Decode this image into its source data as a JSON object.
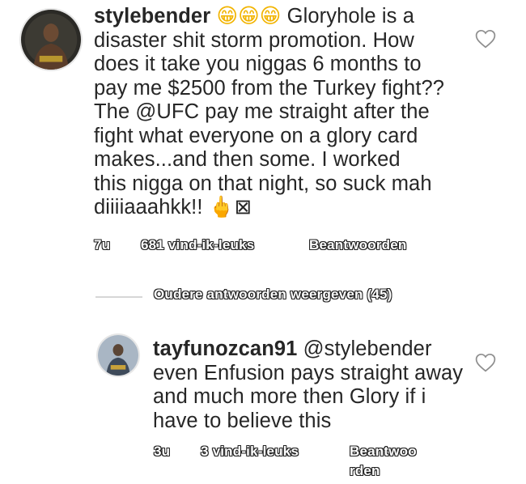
{
  "comments": [
    {
      "username": "stylebender",
      "emojis": "😁😁😁",
      "text_line1": " Gloryhole is a",
      "text_lines": [
        "disaster shit storm promotion. How",
        "does it take you niggas 6 months to",
        "pay me $2500 from the Turkey fight??",
        "The @UFC pay me straight after the",
        "fight what everyone on a glory card",
        "makes...and then some. I worked",
        "this nigga on that night, so suck mah"
      ],
      "last_line": "diiiiaaahkk!! ",
      "last_emoji": "🖕",
      "last_glyph": "⊠",
      "time": "7u",
      "likes": "681 vind-ik-leuks",
      "reply": "Beantwoorden"
    },
    {
      "username": "tayfunozcan91",
      "mention": " @stylebender",
      "text_lines": [
        "even Enfusion pays straight away",
        "and much more then Glory if i",
        "have to believe this"
      ],
      "time": "3u",
      "likes": "3 vind-ik-leuks",
      "reply_line1": "Beantwoo",
      "reply_line2": "rden"
    }
  ],
  "view_replies": "Oudere antwoorden weergeven (45)"
}
